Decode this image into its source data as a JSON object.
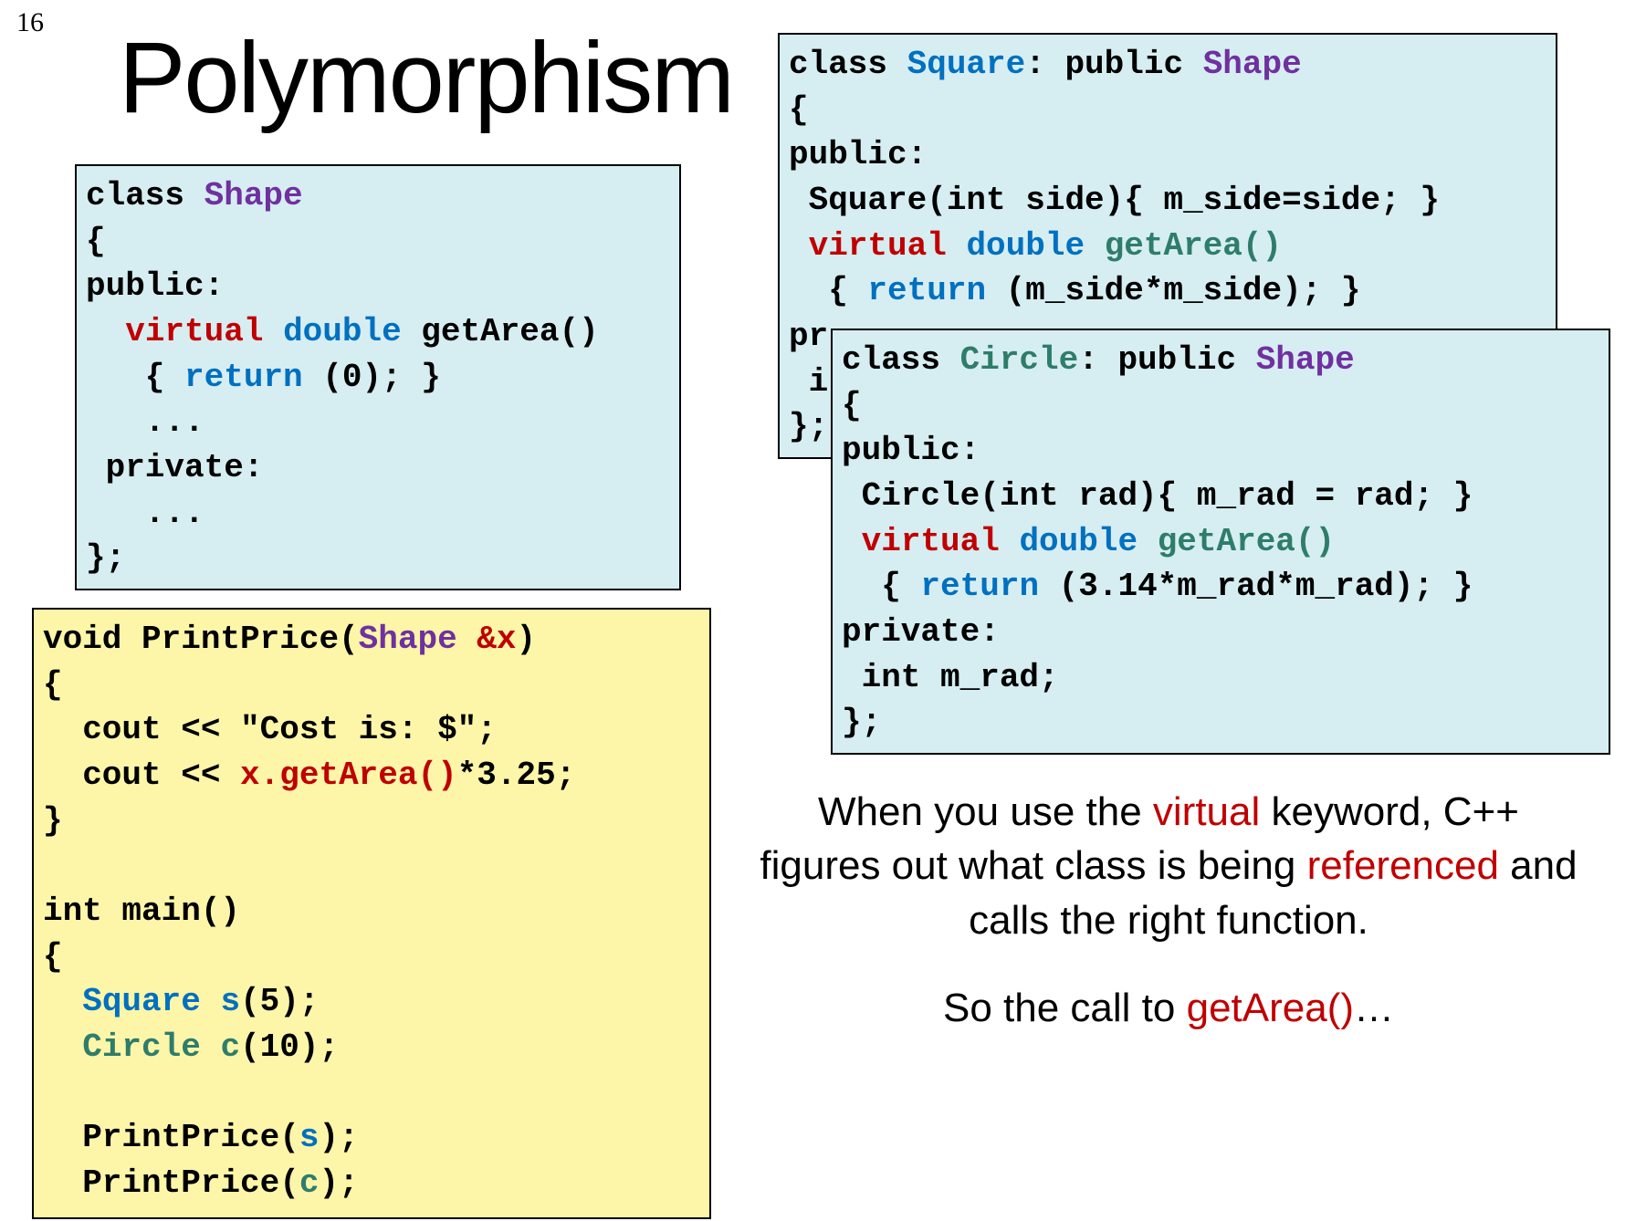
{
  "page_number": "16",
  "title": "Polymorphism",
  "shape_box": {
    "l1a": "class ",
    "l1b": "Shape",
    "l2": "{",
    "l3": "public:",
    "l4a": "  ",
    "l4b": "virtual",
    "l4c": " ",
    "l4d": "double",
    "l4e": " getArea()",
    "l5a": "   { ",
    "l5b": "return",
    "l5c": " (0); }",
    "l6": "   ...",
    "l7": " private:",
    "l8": "   ...",
    "l9": "};"
  },
  "square_box": {
    "l1a": "class ",
    "l1b": "Square",
    "l1c": ": public ",
    "l1d": "Shape",
    "l2": "{",
    "l3": "public:",
    "l4": " Square(int side){ m_side=side; }",
    "l5a": " ",
    "l5b": "virtual",
    "l5c": " ",
    "l5d": "double",
    "l5e": " ",
    "l5f": "getArea()",
    "l6a": "  { ",
    "l6b": "return",
    "l6c": " (m_side*m_side); }",
    "l7": "pr",
    "l8": " i",
    "l9": "};"
  },
  "circle_box": {
    "l1a": "class ",
    "l1b": "Circle",
    "l1c": ": public ",
    "l1d": "Shape",
    "l2": "{",
    "l3": "public:",
    "l4": " Circle(int rad){ m_rad = rad; }",
    "l5a": " ",
    "l5b": "virtual",
    "l5c": " ",
    "l5d": "double",
    "l5e": " ",
    "l5f": "getArea()",
    "l6a": "  { ",
    "l6b": "return",
    "l6c": " (3.14*m_rad*m_rad); }",
    "l7": "private:",
    "l8": " int m_rad;",
    "l9": "};"
  },
  "main_box": {
    "l1a": "void PrintPrice(",
    "l1b": "Shape",
    "l1c": " ",
    "l1d": "&x",
    "l1e": ")",
    "l2": "{",
    "l3": "  cout << \"Cost is: $\";",
    "l4a": "  cout << ",
    "l4b": "x.getArea()",
    "l4c": "*3.25;",
    "l5": "}",
    "blank1": "",
    "l6": "int main()",
    "l7": "{",
    "l8a": "  ",
    "l8b": "Square",
    "l8c": " ",
    "l8d": "s",
    "l8e": "(5);",
    "l9a": "  ",
    "l9b": "Circle",
    "l9c": " ",
    "l9d": "c",
    "l9e": "(10);",
    "blank2": "",
    "l10a": "  PrintPrice(",
    "l10b": "s",
    "l10c": ");",
    "l11a": "  PrintPrice(",
    "l11b": "c",
    "l11c": ");"
  },
  "explain1": {
    "p1": "When you use the ",
    "p2": "virtual",
    "p3": " keyword, C++ figures out what class is being ",
    "p4": "referenced",
    "p5": " and calls the right function."
  },
  "explain2": {
    "p1": "So the call to ",
    "p2": "getArea()",
    "p3": "…"
  }
}
